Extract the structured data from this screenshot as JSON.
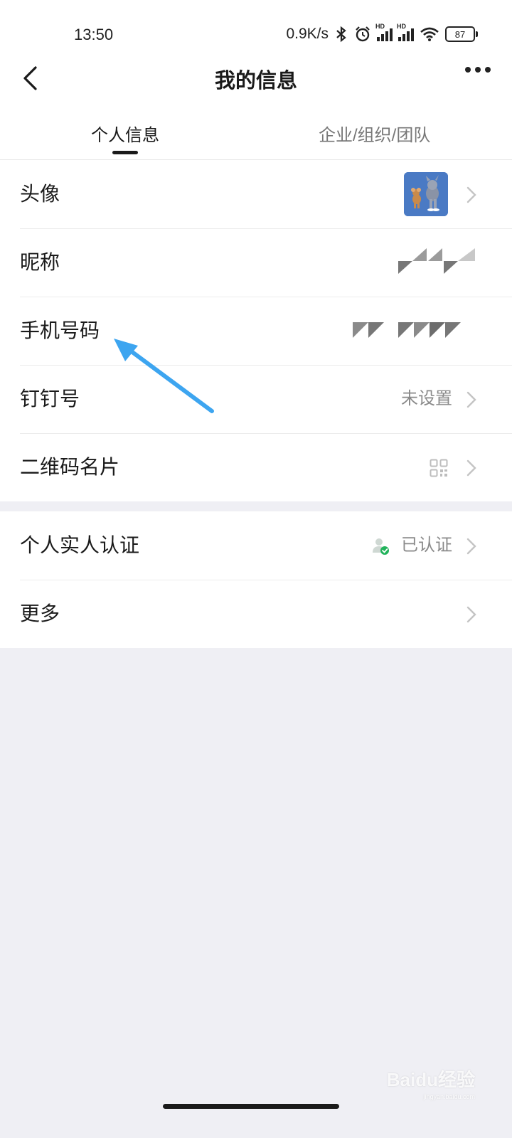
{
  "status_bar": {
    "time": "13:50",
    "net_speed": "0.9K/s",
    "battery": "87",
    "signal_tag": "HD"
  },
  "nav": {
    "title": "我的信息"
  },
  "tabs": [
    {
      "label": "个人信息",
      "active": true
    },
    {
      "label": "企业/组织/团队",
      "active": false
    }
  ],
  "rows": {
    "avatar": {
      "label": "头像"
    },
    "nickname": {
      "label": "昵称"
    },
    "phone": {
      "label": "手机号码"
    },
    "dingtalk_id": {
      "label": "钉钉号",
      "value": "未设置"
    },
    "qr_card": {
      "label": "二维码名片"
    },
    "real_name": {
      "label": "个人实人认证",
      "value": "已认证"
    },
    "more": {
      "label": "更多"
    }
  },
  "watermark": {
    "brand": "Baidu经验",
    "url": "jingyan.baidu.com"
  },
  "colors": {
    "page_bg": "#efeff4",
    "accent_annotation": "#3da5f0",
    "verified_green": "#21b35b",
    "avatar_bg": "#4a7ac4"
  }
}
